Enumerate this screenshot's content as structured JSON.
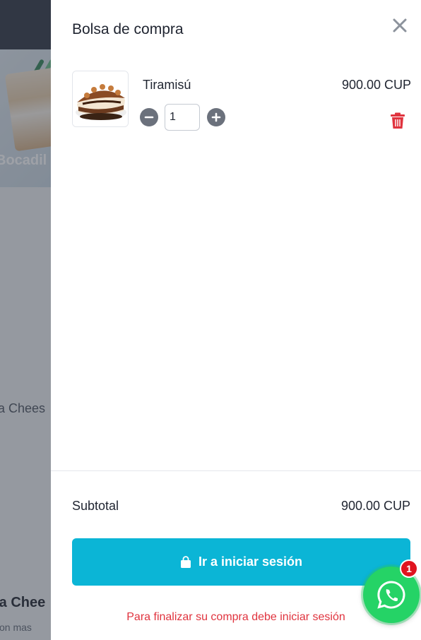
{
  "background": {
    "hero_title": "Bocadil",
    "product_name_1": "ta Chees",
    "product_name_2": "ta Chee",
    "product_desc": "con mas"
  },
  "cart": {
    "title": "Bolsa de compra",
    "close_icon": "close-icon",
    "items": [
      {
        "name": "Tiramisú",
        "price": "900.00 CUP",
        "quantity": "1",
        "image_icon": "cake-image"
      }
    ],
    "subtotal_label": "Subtotal",
    "subtotal_value": "900.00 CUP",
    "login_button_label": "Ir a iniciar sesión",
    "login_note": "Para finalizar su compra debe iniciar sesión"
  },
  "whatsapp": {
    "icon": "whatsapp-icon",
    "badge_count": "1"
  },
  "colors": {
    "accent": "#0bb5d6",
    "danger": "#e0333e",
    "whatsapp": "#25d366"
  }
}
